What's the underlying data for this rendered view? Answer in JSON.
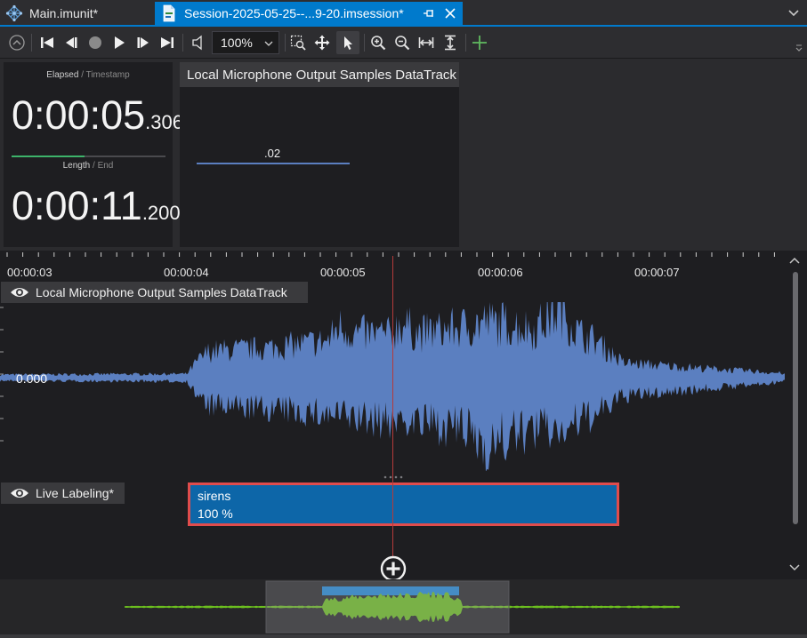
{
  "tabs": [
    {
      "label": "Main.imunit*",
      "active": false,
      "icon": "network-icon"
    },
    {
      "label": "Session-2025-05-25--...9-20.imsession*",
      "active": true,
      "icon": "session-file-icon"
    }
  ],
  "toolbar": {
    "zoom": "100%",
    "buttons": [
      "back-circle-icon",
      "skip-to-start-icon",
      "step-back-icon",
      "record-icon",
      "play-icon",
      "step-forward-icon",
      "skip-to-end-icon",
      "speaker-icon",
      "zoom-rect-icon",
      "pan-icon",
      "pointer-icon",
      "zoom-in-icon",
      "zoom-out-icon",
      "fit-horizontal-icon",
      "fit-vertical-icon",
      "add-icon"
    ]
  },
  "time_panel": {
    "elapsed_caption": "Elapsed",
    "elapsed_caption_sep": " / ",
    "timestamp_caption": "Timestamp",
    "elapsed_main": "0:00:05",
    "elapsed_ms": ".306",
    "length_caption": "Length",
    "length_caption_sep": " / ",
    "end_caption": "End",
    "length_main": "0:00:11",
    "length_ms": ".200",
    "progress_fraction": 0.474,
    "progress_color": "#3db36a"
  },
  "mini_track": {
    "title": "Local Microphone Output Samples DataTrack",
    "value": ".02"
  },
  "timeline": {
    "ticks": [
      "00:00:03",
      "00:00:04",
      "00:00:05",
      "00:00:06",
      "00:00:07"
    ],
    "audio_track": {
      "label": "Local Microphone Output Samples DataTrack",
      "zero_value": "0.000",
      "color": "#5b7fc0"
    },
    "label_track": {
      "label": "Live Labeling*"
    },
    "segment": {
      "name": "sirens",
      "confidence": "100 %",
      "fill": "#0d66a8",
      "border": "#e04c4c"
    },
    "cursor_color": "#b53a3a"
  },
  "overview": {
    "wave_color": "#6cbf1f",
    "highlight_color": "#1e88d8"
  }
}
